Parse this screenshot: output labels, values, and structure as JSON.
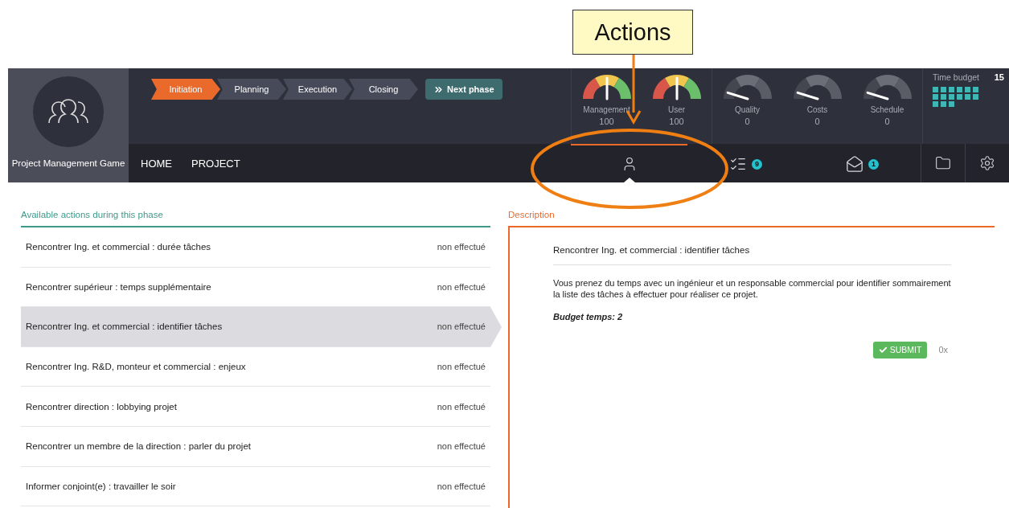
{
  "annotation": {
    "label": "Actions"
  },
  "app": {
    "title": "Project Management Game"
  },
  "phases": [
    {
      "label": "Initiation",
      "selected": true
    },
    {
      "label": "Planning",
      "selected": false
    },
    {
      "label": "Execution",
      "selected": false
    },
    {
      "label": "Closing",
      "selected": false
    }
  ],
  "next_phase": {
    "label": "Next phase"
  },
  "gauges": [
    {
      "label": "Management",
      "value": "100",
      "active": true
    },
    {
      "label": "User",
      "value": "100",
      "active": true
    },
    {
      "label": "Quality",
      "value": "0",
      "active": false
    },
    {
      "label": "Costs",
      "value": "0",
      "active": false
    },
    {
      "label": "Schedule",
      "value": "0",
      "active": false
    }
  ],
  "time_budget": {
    "label": "Time budget",
    "value": "15"
  },
  "nav": {
    "links": [
      "HOME",
      "PROJECT"
    ],
    "tabs": [
      {
        "kind": "actions",
        "selected": true
      },
      {
        "kind": "tasks",
        "badge": "9",
        "selected": false
      },
      {
        "kind": "messages",
        "badge": "1",
        "selected": false
      }
    ],
    "tools": [
      {
        "kind": "folder"
      },
      {
        "kind": "settings"
      }
    ]
  },
  "actions": {
    "title": "Available actions during this phase",
    "rows": [
      {
        "name": "Rencontrer Ing. et commercial : durée tâches",
        "status": "non effectué",
        "selected": false
      },
      {
        "name": "Rencontrer supérieur : temps supplémentaire",
        "status": "non effectué",
        "selected": false
      },
      {
        "name": "Rencontrer Ing. et commercial : identifier tâches",
        "status": "non effectué",
        "selected": true
      },
      {
        "name": "Rencontrer Ing. R&D, monteur et commercial : enjeux",
        "status": "non effectué",
        "selected": false
      },
      {
        "name": "Rencontrer direction : lobbying projet",
        "status": "non effectué",
        "selected": false
      },
      {
        "name": "Rencontrer un membre de la direction : parler du projet",
        "status": "non effectué",
        "selected": false
      },
      {
        "name": "Informer conjoint(e) : travailler le soir",
        "status": "non effectué",
        "selected": false
      }
    ]
  },
  "description": {
    "title": "Description",
    "heading": "Rencontrer Ing. et commercial : identifier tâches",
    "text": "Vous prenez du temps avec un ingénieur et un responsable commercial pour identifier sommairement la liste des tâches à effectuer pour réaliser ce projet.",
    "budget": "Budget temps: 2",
    "submit": "SUBMIT",
    "count": "0x"
  }
}
